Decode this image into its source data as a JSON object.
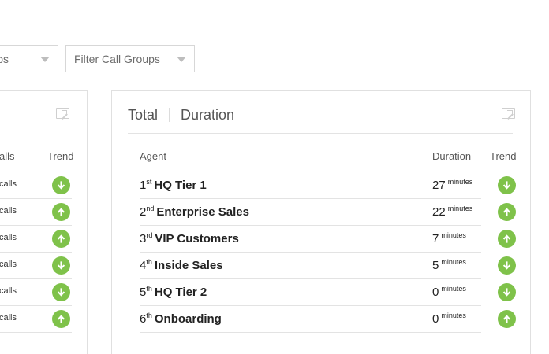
{
  "filters": {
    "left_partial_label": "ps",
    "call_groups_label": "Filter Call Groups"
  },
  "left_panel": {
    "col_calls": "alls",
    "col_trend": "Trend",
    "rows": [
      {
        "calls": "calls",
        "trend": "down"
      },
      {
        "calls": "calls",
        "trend": "up"
      },
      {
        "calls": "calls",
        "trend": "up"
      },
      {
        "calls": "calls",
        "trend": "down"
      },
      {
        "calls": "calls",
        "trend": "down"
      },
      {
        "calls": "calls",
        "trend": "up"
      }
    ]
  },
  "right_panel": {
    "tab_total": "Total",
    "tab_duration": "Duration",
    "col_agent": "Agent",
    "col_duration": "Duration",
    "col_trend": "Trend",
    "rows": [
      {
        "rank": "1",
        "suffix": "st",
        "name": "HQ Tier 1",
        "duration": "27",
        "unit": "minutes",
        "trend": "down"
      },
      {
        "rank": "2",
        "suffix": "nd",
        "name": "Enterprise Sales",
        "duration": "22",
        "unit": "minutes",
        "trend": "up"
      },
      {
        "rank": "3",
        "suffix": "rd",
        "name": "VIP Customers",
        "duration": "7",
        "unit": "minutes",
        "trend": "up"
      },
      {
        "rank": "4",
        "suffix": "th",
        "name": "Inside Sales",
        "duration": "5",
        "unit": "minutes",
        "trend": "down"
      },
      {
        "rank": "5",
        "suffix": "th",
        "name": "HQ Tier 2",
        "duration": "0",
        "unit": "minutes",
        "trend": "down"
      },
      {
        "rank": "6",
        "suffix": "th",
        "name": "Onboarding",
        "duration": "0",
        "unit": "minutes",
        "trend": "up"
      }
    ]
  },
  "colors": {
    "trend_green": "#7fc24a"
  }
}
